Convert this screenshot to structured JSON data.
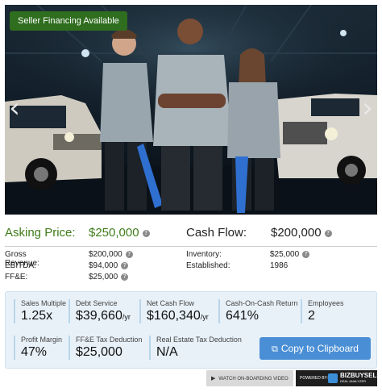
{
  "hero": {
    "badge": "Seller Financing Available",
    "prev_icon": "chevron-left-icon",
    "next_icon": "chevron-right-icon"
  },
  "price": {
    "asking_label": "Asking Price:",
    "asking_value": "$250,000",
    "cashflow_label": "Cash Flow:",
    "cashflow_value": "$200,000"
  },
  "details": {
    "gross_revenue_label": "Gross Revenue:",
    "gross_revenue_value": "$200,000",
    "ebitda_label": "EBITDA:",
    "ebitda_value": "$94,000",
    "ffe_label": "FF&E:",
    "ffe_value": "$25,000",
    "inventory_label": "Inventory:",
    "inventory_value": "$25,000",
    "established_label": "Established:",
    "established_value": "1986"
  },
  "metrics": {
    "sales_multiple_label": "Sales Multiple",
    "sales_multiple_value": "1.25x",
    "debt_service_label": "Debt Service",
    "debt_service_value": "$39,660",
    "debt_service_unit": "/yr",
    "net_cash_flow_label": "Net Cash Flow",
    "net_cash_flow_value": "$160,340",
    "net_cash_flow_unit": "/yr",
    "coc_label": "Cash-On-Cash Return",
    "coc_value": "641%",
    "employees_label": "Employees",
    "employees_value": "2",
    "profit_margin_label": "Profit Margin",
    "profit_margin_value": "47%",
    "ffe_tax_label": "FF&E Tax Deduction",
    "ffe_tax_value": "$25,000",
    "re_tax_label": "Real Estate Tax Deduction",
    "re_tax_value": "N/A",
    "copy_button": "Copy to Clipboard"
  },
  "footer": {
    "video_label": "WATCH ON-BOARDING VIDEO",
    "powered_label": "POWERED BY:",
    "brand_name": "BIZBUYSELL",
    "brand_sub": "DEAL ANALYZER"
  }
}
